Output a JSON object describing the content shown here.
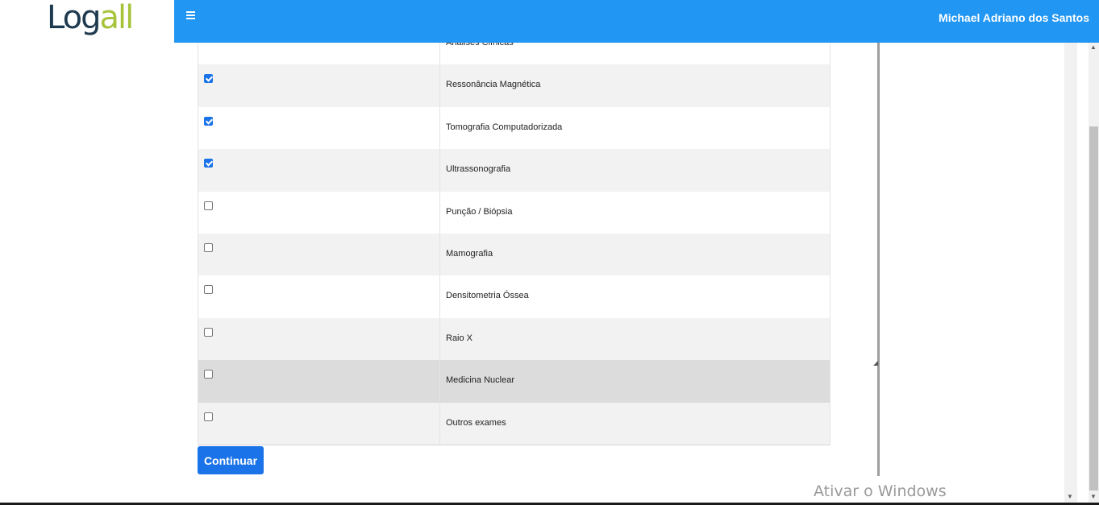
{
  "header": {
    "logo": "Logall",
    "user_name": "Michael Adriano dos Santos",
    "menu_icon": "hamburger-menu-icon",
    "brand_color": "#2196f3"
  },
  "exam_list": {
    "partial_top_item": "Análises Clínicas",
    "items": [
      {
        "label": "Ressonância Magnética",
        "checked": true
      },
      {
        "label": "Tomografia Computadorizada",
        "checked": true
      },
      {
        "label": "Ultrassonografia",
        "checked": true
      },
      {
        "label": "Punção / Biópsia",
        "checked": false
      },
      {
        "label": "Mamografia",
        "checked": false
      },
      {
        "label": "Densitometria Óssea",
        "checked": false
      },
      {
        "label": "Raio X",
        "checked": false
      },
      {
        "label": "Medicina Nuclear",
        "checked": false
      },
      {
        "label": "Outros exames",
        "checked": false
      }
    ]
  },
  "actions": {
    "continue_label": "Continuar"
  },
  "overlay": {
    "watermark": "Ativar o Windows"
  }
}
